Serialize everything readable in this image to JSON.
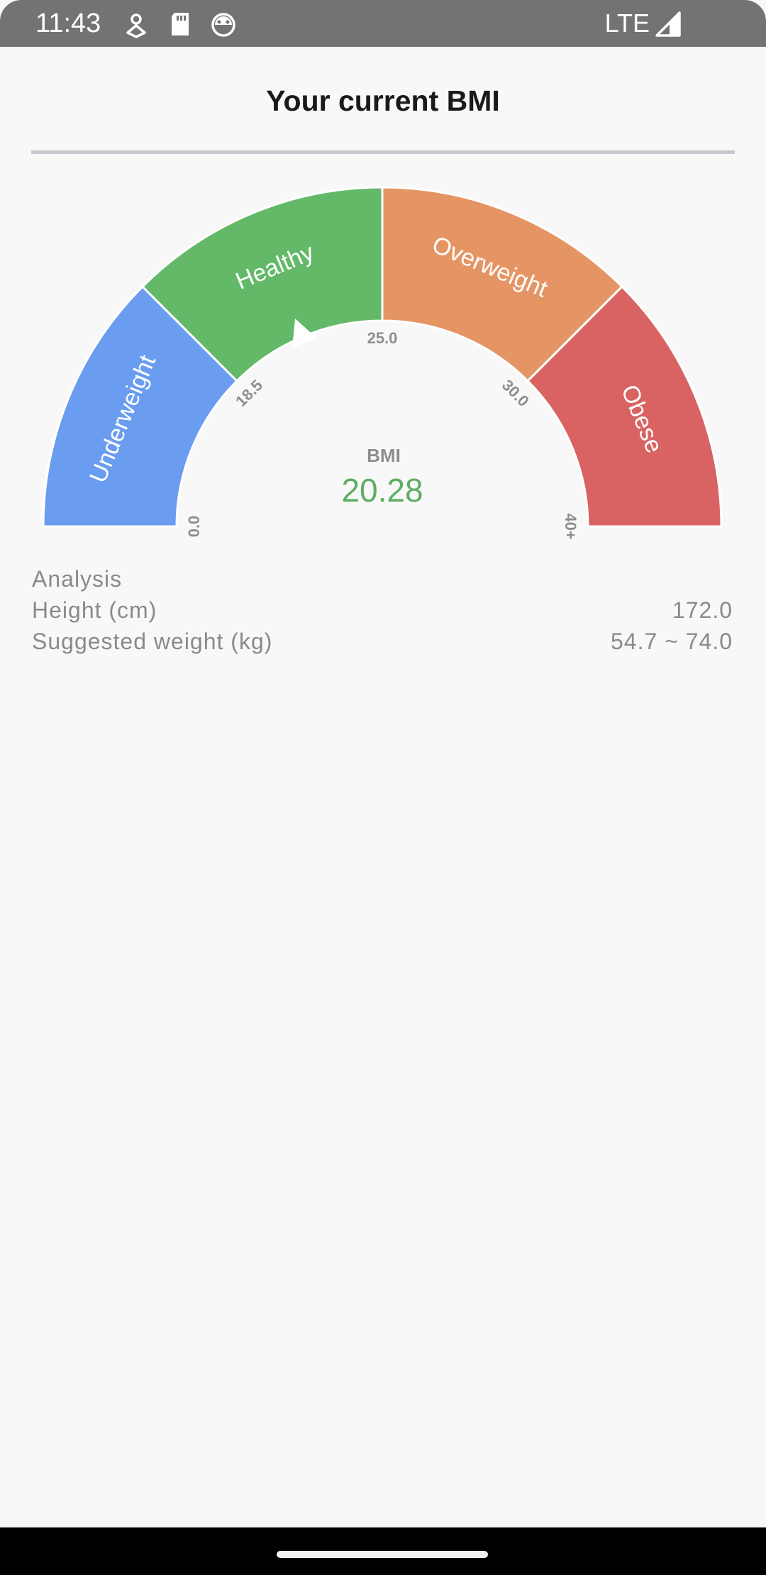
{
  "status_bar": {
    "time": "11:43",
    "network": "LTE",
    "icons": [
      "notification-icon",
      "sd-card-icon",
      "robot-face-icon",
      "signal-icon"
    ]
  },
  "header": {
    "title": "Your current BMI"
  },
  "gauge": {
    "segments": [
      {
        "label": "Underweight",
        "color": "#6a9cf0"
      },
      {
        "label": "Healthy",
        "color": "#63b967"
      },
      {
        "label": "Overweight",
        "color": "#e59564"
      },
      {
        "label": "Obese",
        "color": "#d86362"
      }
    ],
    "ticks": [
      "0.0",
      "18.5",
      "25.0",
      "30.0",
      "40+"
    ],
    "center_label": "BMI",
    "value": "20.28",
    "value_color": "#5cae62"
  },
  "analysis": {
    "heading": "Analysis",
    "rows": [
      {
        "label": "Height (cm)",
        "value": "172.0"
      },
      {
        "label": "Suggested weight (kg)",
        "value": "54.7 ~ 74.0"
      }
    ]
  }
}
